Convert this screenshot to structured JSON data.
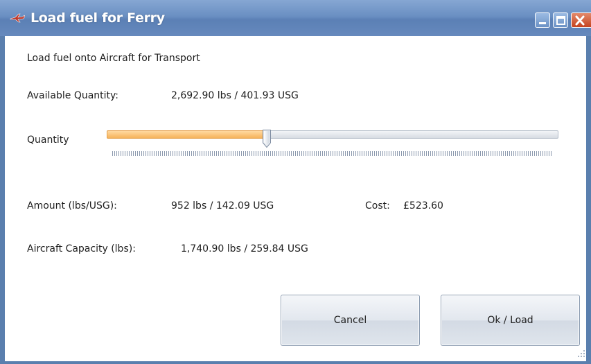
{
  "window": {
    "title": "Load fuel for Ferry",
    "title_icon": "airplane-icon",
    "controls": [
      "minimize-icon",
      "maximize-icon",
      "close-icon"
    ]
  },
  "content": {
    "heading": "Load fuel onto Aircraft for Transport",
    "available_label": "Available Quantity:",
    "available_value": "2,692.90 lbs / 401.93 USG",
    "quantity_label": "Quantity",
    "quantity_fraction": 0.354,
    "amount_label": "Amount (lbs/USG):",
    "amount_value": "952 lbs / 142.09 USG",
    "cost_label": "Cost:",
    "cost_value": "£523.60",
    "capacity_label": "Aircraft Capacity (lbs):",
    "capacity_value": "1,740.90 lbs / 259.84 USG"
  },
  "buttons": {
    "cancel": "Cancel",
    "ok": "Ok / Load"
  },
  "colors": {
    "titlebar": "#6a8fc2",
    "slider_fill": "#f6b35b",
    "close_button": "#c6431f"
  }
}
